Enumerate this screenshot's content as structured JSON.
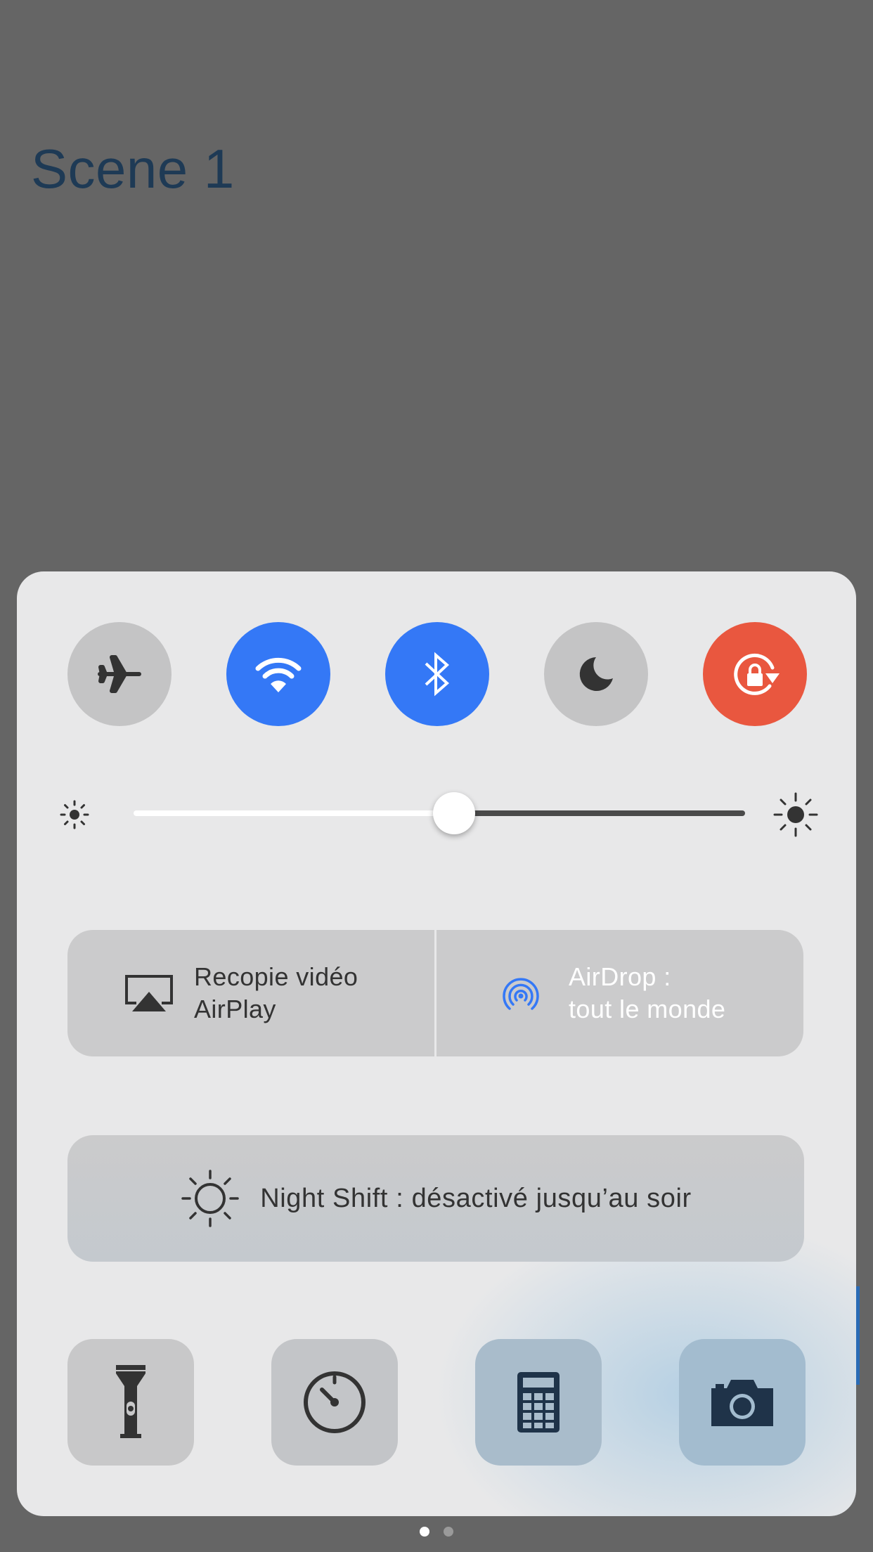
{
  "background_app": {
    "title": "Scene 1"
  },
  "control_center": {
    "toggles": [
      {
        "id": "airplane",
        "icon": "airplane-icon",
        "on": false,
        "color": "#c4c4c5"
      },
      {
        "id": "wifi",
        "icon": "wifi-icon",
        "on": true,
        "color": "#3478f6"
      },
      {
        "id": "bluetooth",
        "icon": "bluetooth-icon",
        "on": true,
        "color": "#3478f6"
      },
      {
        "id": "do-not-disturb",
        "icon": "moon-icon",
        "on": false,
        "color": "#c4c4c5"
      },
      {
        "id": "rotation-lock",
        "icon": "rotation-lock-icon",
        "on": true,
        "color": "#e9573f"
      }
    ],
    "brightness": {
      "level": 0.51
    },
    "airplay": {
      "line1": "Recopie vidéo",
      "line2": "AirPlay",
      "icon": "airplay-icon"
    },
    "airdrop": {
      "line1": "AirDrop :",
      "line2": "tout le monde",
      "icon": "airdrop-icon",
      "accent": "#3478f6"
    },
    "night_shift": {
      "label": "Night Shift : désactivé jusqu’au soir",
      "icon": "night-shift-icon"
    },
    "shortcuts": [
      {
        "id": "flashlight",
        "icon": "flashlight-icon"
      },
      {
        "id": "timer",
        "icon": "timer-icon"
      },
      {
        "id": "calculator",
        "icon": "calculator-icon"
      },
      {
        "id": "camera",
        "icon": "camera-icon"
      }
    ],
    "pages": {
      "current": 1,
      "total": 2
    }
  }
}
